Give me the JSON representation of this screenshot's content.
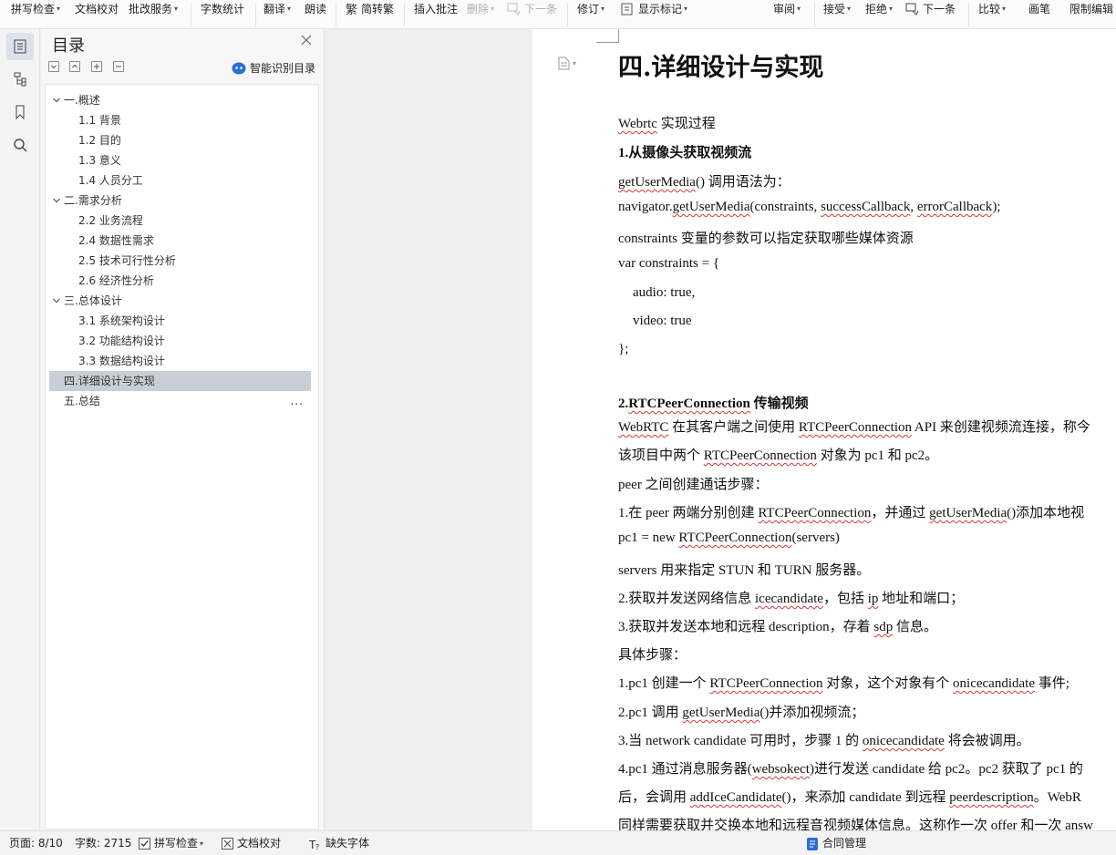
{
  "toolbar": {
    "spell_check": "拼写检查",
    "doc_proof": "文档校对",
    "batch_service": "批改服务",
    "word_count": "字数统计",
    "translate": "翻译",
    "read_aloud": "朗读",
    "simp_trad": "简转繁",
    "insert_comment": "插入批注",
    "delete": "删除",
    "next": "下一条",
    "revise": "修订",
    "show_marks": "显示标记",
    "review": "审阅",
    "accept": "接受",
    "reject": "拒绝",
    "next2": "下一条",
    "compare": "比较",
    "pen": "画笔",
    "restrict_edit": "限制编辑"
  },
  "toc": {
    "title": "目录",
    "smart_label": "智能识别目录",
    "items": [
      {
        "label": "一.概述"
      },
      {
        "label": "1.1 背景"
      },
      {
        "label": "1.2 目的"
      },
      {
        "label": "1.3 意义"
      },
      {
        "label": "1.4 人员分工"
      },
      {
        "label": "二.需求分析"
      },
      {
        "label": "2.2 业务流程"
      },
      {
        "label": "2.4 数据性需求"
      },
      {
        "label": "2.5 技术可行性分析"
      },
      {
        "label": "2.6 经济性分析"
      },
      {
        "label": "三.总体设计"
      },
      {
        "label": "3.1 系统架构设计"
      },
      {
        "label": "3.2 功能结构设计"
      },
      {
        "label": "3.3 数据结构设计"
      },
      {
        "label": "四.详细设计与实现"
      },
      {
        "label": "五.总结"
      }
    ],
    "more_label": "..."
  },
  "document": {
    "heading": "四.详细设计与实现",
    "lines": [
      {
        "parts": [
          [
            "Webrtc",
            true
          ],
          [
            " 实现过程",
            false
          ]
        ]
      },
      {
        "parts": [
          [
            "1.从摄像头获取视频流",
            false
          ]
        ]
      },
      {
        "parts": [
          [
            "getUserMedia",
            true
          ],
          [
            "() 调用语法为：",
            false
          ]
        ]
      },
      {
        "parts": [
          [
            "navigator.",
            false
          ],
          [
            "getUserMedia",
            true
          ],
          [
            "(constraints, ",
            false
          ],
          [
            "successCallback",
            true
          ],
          [
            ", ",
            false
          ],
          [
            "errorCallback",
            true
          ],
          [
            ");",
            false
          ]
        ]
      },
      {
        "parts": [
          [
            "constraints 变量的参数可以指定获取哪些媒体资源",
            false
          ]
        ]
      },
      {
        "parts": [
          [
            "var constraints = {",
            false
          ]
        ]
      },
      {
        "parts": [
          [
            "audio: true,",
            false
          ]
        ]
      },
      {
        "parts": [
          [
            "video: true",
            false
          ]
        ]
      },
      {
        "parts": [
          [
            "};",
            false
          ]
        ]
      },
      {
        "parts": [
          [
            "2.",
            false
          ],
          [
            "RTCPeerConnection",
            true
          ],
          [
            " 传输视频",
            false
          ]
        ]
      },
      {
        "parts": [
          [
            "WebRTC",
            true
          ],
          [
            " 在其客户端之间使用  ",
            false
          ],
          [
            "RTCPeerConnection",
            true
          ],
          [
            " API 来创建视频流连接，称今",
            false
          ]
        ]
      },
      {
        "parts": [
          [
            "该项目中两个 ",
            false
          ],
          [
            "RTCPeerConnection",
            true
          ],
          [
            " 对象为 pc1 和 pc2。",
            false
          ]
        ]
      },
      {
        "parts": [
          [
            "peer 之间创建通话步骤：",
            false
          ]
        ]
      },
      {
        "parts": [
          [
            "1.在 peer 两端分别创建 ",
            false
          ],
          [
            "RTCPeerConnection",
            true
          ],
          [
            "，并通过 ",
            false
          ],
          [
            "getUserMedia",
            true
          ],
          [
            "()添加本地视",
            false
          ]
        ]
      },
      {
        "parts": [
          [
            "pc1 = new ",
            false
          ],
          [
            "RTCPeerConnection",
            true
          ],
          [
            "(servers)",
            false
          ]
        ]
      },
      {
        "parts": [
          [
            "servers 用来指定 STUN 和 TURN 服务器。",
            false
          ]
        ]
      },
      {
        "parts": [
          [
            "2.获取并发送网络信息 ",
            false
          ],
          [
            "icecandidate",
            true
          ],
          [
            "，包括 ",
            false
          ],
          [
            "ip",
            true
          ],
          [
            " 地址和端口；",
            false
          ]
        ]
      },
      {
        "parts": [
          [
            "3.获取并发送本地和远程 description，存着 ",
            false
          ],
          [
            "sdp",
            true
          ],
          [
            " 信息。",
            false
          ]
        ]
      },
      {
        "parts": [
          [
            "具体步骤：",
            false
          ]
        ]
      },
      {
        "parts": [
          [
            "1.pc1 创建一个 ",
            false
          ],
          [
            "RTCPeerConnection",
            true
          ],
          [
            " 对象，这个对象有个 ",
            false
          ],
          [
            "onicecandidate",
            true
          ],
          [
            " 事件;",
            false
          ]
        ]
      },
      {
        "parts": [
          [
            "2.pc1 调用 ",
            false
          ],
          [
            "getUserMedia",
            true
          ],
          [
            "()并添加视频流；",
            false
          ]
        ]
      },
      {
        "parts": [
          [
            "3.当 network candidate 可用时，步骤 1 的 ",
            false
          ],
          [
            "onicecandidate",
            true
          ],
          [
            " 将会被调用。",
            false
          ]
        ]
      },
      {
        "parts": [
          [
            "4.pc1 通过消息服务器(",
            false
          ],
          [
            "websokect",
            true
          ],
          [
            ")进行发送 candidate 给 pc2。pc2 获取了 pc1 的",
            false
          ]
        ]
      },
      {
        "parts": [
          [
            "后，会调用 ",
            false
          ],
          [
            "addIceCandidate",
            true
          ],
          [
            "()，来添加 candidate 到远程 ",
            false
          ],
          [
            "peerdescription",
            true
          ],
          [
            "。WebR",
            false
          ]
        ]
      },
      {
        "parts": [
          [
            "同样需要获取并交换本地和远程音视频媒体信息。这称作一次 offer 和一次 answ",
            false
          ]
        ]
      }
    ]
  },
  "status": {
    "page": "页面: 8/10",
    "words": "字数: 2715",
    "spell": "拼写检查",
    "proof": "文档校对",
    "missing_font": "缺失字体",
    "contract": "合同管理"
  },
  "colors": {
    "accent": "#2a6ed8",
    "selected": "#c8ced6",
    "squiggle": "#d23b3b"
  }
}
